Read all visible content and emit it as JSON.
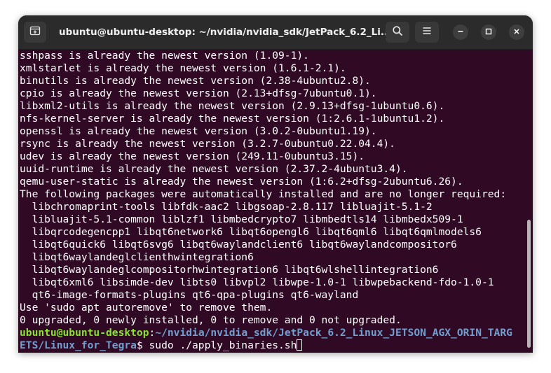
{
  "window": {
    "title": "ubuntu@ubuntu-desktop: ~/nvidia/nvidia_sdk/JetPack_6.2_Li..."
  },
  "icons": {
    "new_tab": "new-tab-icon",
    "search": "search-icon",
    "menu": "hamburger-menu-icon",
    "minimize": "minimize-icon",
    "maximize": "maximize-icon",
    "close": "close-icon"
  },
  "colors": {
    "terminal_bg": "#300a24",
    "titlebar_bg": "#2b2b2b",
    "prompt_user": "#8ae234",
    "prompt_path": "#729fcf",
    "text": "#ffffff"
  },
  "terminal": {
    "lines": [
      "sshpass is already the newest version (1.09-1).",
      "xmlstarlet is already the newest version (1.6.1-2.1).",
      "binutils is already the newest version (2.38-4ubuntu2.8).",
      "cpio is already the newest version (2.13+dfsg-7ubuntu0.1).",
      "libxml2-utils is already the newest version (2.9.13+dfsg-1ubuntu0.6).",
      "nfs-kernel-server is already the newest version (1:2.6.1-1ubuntu1.2).",
      "openssl is already the newest version (3.0.2-0ubuntu1.19).",
      "rsync is already the newest version (3.2.7-0ubuntu0.22.04.4).",
      "udev is already the newest version (249.11-0ubuntu3.15).",
      "uuid-runtime is already the newest version (2.37.2-4ubuntu3.4).",
      "qemu-user-static is already the newest version (1:6.2+dfsg-2ubuntu6.26).",
      "The following packages were automatically installed and are no longer required:",
      "  libchromaprint-tools libfdk-aac2 libgsoap-2.8.117 libluajit-5.1-2",
      "  libluajit-5.1-common liblzf1 libmbedcrypto7 libmbedtls14 libmbedx509-1",
      "  libqrcodegencpp1 libqt6network6 libqt6opengl6 libqt6qml6 libqt6qmlmodels6",
      "  libqt6quick6 libqt6svg6 libqt6waylandclient6 libqt6waylandcompositor6",
      "  libqt6waylandeglclienthwintegration6",
      "  libqt6waylandeglcompositorhwintegration6 libqt6wlshellintegration6",
      "  libqt6xml6 libsimde-dev libts0 libvpl2 libwpe-1.0-1 libwpebackend-fdo-1.0-1",
      "  qt6-image-formats-plugins qt6-qpa-plugins qt6-wayland",
      "Use 'sudo apt autoremove' to remove them.",
      "0 upgraded, 0 newly installed, 0 to remove and 0 not upgraded."
    ],
    "prompt": {
      "user_host": "ubuntu@ubuntu-desktop",
      "separator": ":",
      "path_line1": "~/nvidia/nvidia_sdk/JetPack_6.2_Linux_JETSON_AGX_ORIN_TARG",
      "path_line2": "ETS/Linux_for_Tegra",
      "symbol": "$ ",
      "command": "sudo ./apply_binaries.sh"
    }
  }
}
